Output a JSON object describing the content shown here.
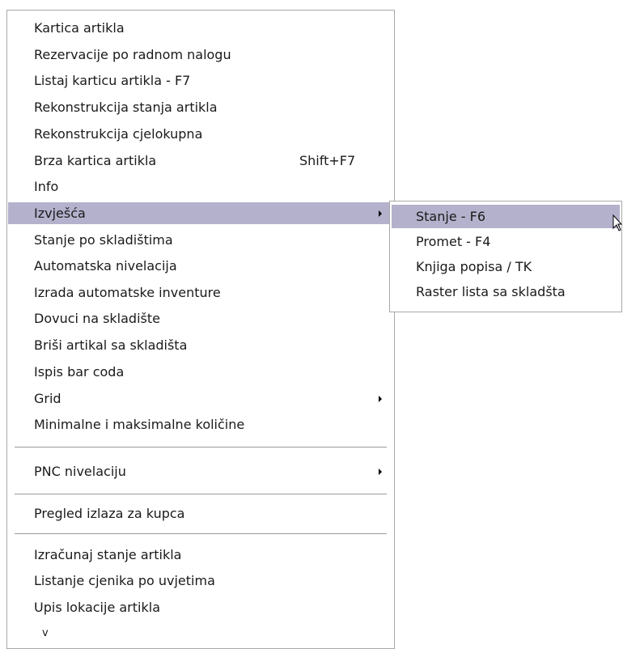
{
  "menu": {
    "items": [
      {
        "label": "Kartica artikla"
      },
      {
        "label": "Rezervacije po radnom nalogu"
      },
      {
        "label": "Listaj karticu artikla   - F7"
      },
      {
        "label": "Rekonstrukcija stanja artikla"
      },
      {
        "label": "Rekonstrukcija cjelokupna"
      },
      {
        "label": "Brza kartica artikla",
        "shortcut": "Shift+F7"
      },
      {
        "label": "Info"
      },
      {
        "label": "Izvješća",
        "selected": true,
        "has_submenu": true
      },
      {
        "label": "Stanje po skladištima"
      },
      {
        "label": "Automatska nivelacija"
      },
      {
        "label": "Izrada automatske inventure"
      },
      {
        "label": "Dovuci na skladište"
      },
      {
        "label": "Briši artikal sa skladišta"
      },
      {
        "label": "Ispis bar coda"
      },
      {
        "label": "Grid",
        "has_submenu": true
      },
      {
        "label": "Minimalne i maksimalne količine"
      },
      {
        "label": "PNC nivelaciju",
        "has_submenu": true
      },
      {
        "label": "Pregled izlaza za kupca"
      },
      {
        "label": "Izračunaj stanje artikla"
      },
      {
        "label": "Listanje cjenika po uvjetima"
      },
      {
        "label": "Upis lokacije artikla"
      }
    ],
    "more_indicator": "v"
  },
  "submenu": {
    "items": [
      {
        "label": "Stanje   - F6",
        "selected": true
      },
      {
        "label": "Promet   - F4"
      },
      {
        "label": "Knjiga popisa / TK"
      },
      {
        "label": "Raster lista sa skladšta"
      }
    ]
  },
  "colors": {
    "highlight": "#b3b1cc",
    "border": "#a9a9a9",
    "separator": "#9a9a9a"
  },
  "icons": {
    "submenu_arrow": "triangle-right-icon",
    "cursor": "mouse-pointer-icon"
  }
}
